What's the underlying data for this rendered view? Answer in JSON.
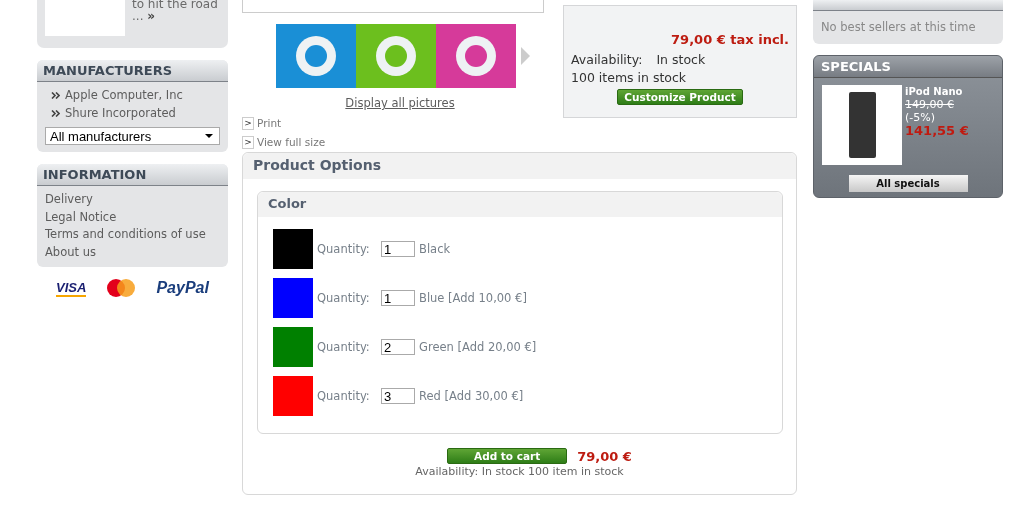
{
  "featured": {
    "text": "to hit the road",
    "ellipsis": "...",
    "more": "»"
  },
  "manufacturers": {
    "title": "MANUFACTURERS",
    "items": [
      "Apple Computer, Inc",
      "Shure Incorporated"
    ],
    "select": "All manufacturers"
  },
  "information": {
    "title": "INFORMATION",
    "items": [
      "Delivery",
      "Legal Notice",
      "Terms and conditions of use",
      "About us"
    ]
  },
  "payment_logos": [
    {
      "kind": "visa",
      "text": "VISA"
    },
    {
      "kind": "mastercard"
    },
    {
      "kind": "paypal",
      "text": "PayPal"
    }
  ],
  "gallery": {
    "thumbnails": [
      {
        "color": "#1a8fd6"
      },
      {
        "color": "#6cbf1e"
      },
      {
        "color": "#d63a9a"
      }
    ],
    "link": "Display all pictures"
  },
  "actions": [
    {
      "icon": ">",
      "label": "Print"
    },
    {
      "icon": ">",
      "label": "View full size"
    }
  ],
  "price_box": {
    "price": "79,00 € tax incl.",
    "availability_label": "Availability:",
    "availability_value": "In stock",
    "stock": "100 items in stock",
    "button": "Customize Product"
  },
  "product_options": {
    "title": "Product Options",
    "group": "Color",
    "options": [
      {
        "color": "#000000",
        "label": "Quantity:",
        "quantity": "1",
        "name": "Black"
      },
      {
        "color": "#0000ff",
        "label": "Quantity:",
        "quantity": "1",
        "name": "Blue [Add 10,00 €]"
      },
      {
        "color": "#008000",
        "label": "Quantity:",
        "quantity": "2",
        "name": "Green [Add 20,00 €]"
      },
      {
        "color": "#ff0000",
        "label": "Quantity:",
        "quantity": "3",
        "name": "Red [Add 30,00 €]"
      }
    ],
    "add_to_cart": "Add to cart",
    "price": "79,00 €",
    "availability": "Availability: In stock 100 item in stock"
  },
  "top_sellers": {
    "empty": "No best sellers at this time"
  },
  "specials": {
    "title": "SPECIALS",
    "product": "iPod Nano",
    "old_price": "149,00 €",
    "discount": "(-5%)",
    "price": "141,55 €",
    "button": "All specials"
  }
}
